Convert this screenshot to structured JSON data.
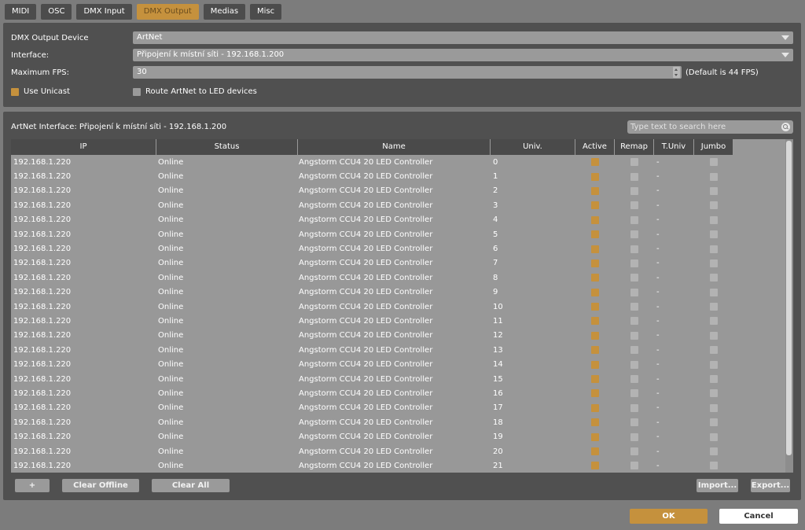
{
  "tabs": [
    "MIDI",
    "OSC",
    "DMX Input",
    "DMX Output",
    "Medias",
    "Misc"
  ],
  "active_tab": "DMX Output",
  "settings": {
    "device_label": "DMX Output Device",
    "device_value": "ArtNet",
    "interface_label": "Interface:",
    "interface_value": "Připojení k místní síti - 192.168.1.200",
    "fps_label": "Maximum FPS:",
    "fps_value": "30",
    "fps_hint": "(Default is 44 FPS)",
    "use_unicast_label": "Use Unicast",
    "use_unicast_checked": true,
    "route_label": "Route ArtNet to LED devices",
    "route_checked": false
  },
  "panel": {
    "interface_label": "ArtNet Interface: Připojení k místní síti - 192.168.1.200",
    "search_placeholder": "Type text to search here"
  },
  "table": {
    "headers": [
      "IP",
      "Status",
      "Name",
      "Univ.",
      "Active",
      "Remap",
      "T.Univ",
      "Jumbo"
    ],
    "rows": [
      {
        "ip": "192.168.1.220",
        "status": "Online",
        "name": "Angstorm CCU4 20 LED Controller",
        "univ": "0",
        "active": true,
        "remap": false,
        "tuniv": "-",
        "jumbo": false
      },
      {
        "ip": "192.168.1.220",
        "status": "Online",
        "name": "Angstorm CCU4 20 LED Controller",
        "univ": "1",
        "active": true,
        "remap": false,
        "tuniv": "-",
        "jumbo": false
      },
      {
        "ip": "192.168.1.220",
        "status": "Online",
        "name": "Angstorm CCU4 20 LED Controller",
        "univ": "2",
        "active": true,
        "remap": false,
        "tuniv": "-",
        "jumbo": false
      },
      {
        "ip": "192.168.1.220",
        "status": "Online",
        "name": "Angstorm CCU4 20 LED Controller",
        "univ": "3",
        "active": true,
        "remap": false,
        "tuniv": "-",
        "jumbo": false
      },
      {
        "ip": "192.168.1.220",
        "status": "Online",
        "name": "Angstorm CCU4 20 LED Controller",
        "univ": "4",
        "active": true,
        "remap": false,
        "tuniv": "-",
        "jumbo": false
      },
      {
        "ip": "192.168.1.220",
        "status": "Online",
        "name": "Angstorm CCU4 20 LED Controller",
        "univ": "5",
        "active": true,
        "remap": false,
        "tuniv": "-",
        "jumbo": false
      },
      {
        "ip": "192.168.1.220",
        "status": "Online",
        "name": "Angstorm CCU4 20 LED Controller",
        "univ": "6",
        "active": true,
        "remap": false,
        "tuniv": "-",
        "jumbo": false
      },
      {
        "ip": "192.168.1.220",
        "status": "Online",
        "name": "Angstorm CCU4 20 LED Controller",
        "univ": "7",
        "active": true,
        "remap": false,
        "tuniv": "-",
        "jumbo": false
      },
      {
        "ip": "192.168.1.220",
        "status": "Online",
        "name": "Angstorm CCU4 20 LED Controller",
        "univ": "8",
        "active": true,
        "remap": false,
        "tuniv": "-",
        "jumbo": false
      },
      {
        "ip": "192.168.1.220",
        "status": "Online",
        "name": "Angstorm CCU4 20 LED Controller",
        "univ": "9",
        "active": true,
        "remap": false,
        "tuniv": "-",
        "jumbo": false
      },
      {
        "ip": "192.168.1.220",
        "status": "Online",
        "name": "Angstorm CCU4 20 LED Controller",
        "univ": "10",
        "active": true,
        "remap": false,
        "tuniv": "-",
        "jumbo": false
      },
      {
        "ip": "192.168.1.220",
        "status": "Online",
        "name": "Angstorm CCU4 20 LED Controller",
        "univ": "11",
        "active": true,
        "remap": false,
        "tuniv": "-",
        "jumbo": false
      },
      {
        "ip": "192.168.1.220",
        "status": "Online",
        "name": "Angstorm CCU4 20 LED Controller",
        "univ": "12",
        "active": true,
        "remap": false,
        "tuniv": "-",
        "jumbo": false
      },
      {
        "ip": "192.168.1.220",
        "status": "Online",
        "name": "Angstorm CCU4 20 LED Controller",
        "univ": "13",
        "active": true,
        "remap": false,
        "tuniv": "-",
        "jumbo": false
      },
      {
        "ip": "192.168.1.220",
        "status": "Online",
        "name": "Angstorm CCU4 20 LED Controller",
        "univ": "14",
        "active": true,
        "remap": false,
        "tuniv": "-",
        "jumbo": false
      },
      {
        "ip": "192.168.1.220",
        "status": "Online",
        "name": "Angstorm CCU4 20 LED Controller",
        "univ": "15",
        "active": true,
        "remap": false,
        "tuniv": "-",
        "jumbo": false
      },
      {
        "ip": "192.168.1.220",
        "status": "Online",
        "name": "Angstorm CCU4 20 LED Controller",
        "univ": "16",
        "active": true,
        "remap": false,
        "tuniv": "-",
        "jumbo": false
      },
      {
        "ip": "192.168.1.220",
        "status": "Online",
        "name": "Angstorm CCU4 20 LED Controller",
        "univ": "17",
        "active": true,
        "remap": false,
        "tuniv": "-",
        "jumbo": false
      },
      {
        "ip": "192.168.1.220",
        "status": "Online",
        "name": "Angstorm CCU4 20 LED Controller",
        "univ": "18",
        "active": true,
        "remap": false,
        "tuniv": "-",
        "jumbo": false
      },
      {
        "ip": "192.168.1.220",
        "status": "Online",
        "name": "Angstorm CCU4 20 LED Controller",
        "univ": "19",
        "active": true,
        "remap": false,
        "tuniv": "-",
        "jumbo": false
      },
      {
        "ip": "192.168.1.220",
        "status": "Online",
        "name": "Angstorm CCU4 20 LED Controller",
        "univ": "20",
        "active": true,
        "remap": false,
        "tuniv": "-",
        "jumbo": false
      },
      {
        "ip": "192.168.1.220",
        "status": "Online",
        "name": "Angstorm CCU4 20 LED Controller",
        "univ": "21",
        "active": true,
        "remap": false,
        "tuniv": "-",
        "jumbo": false
      }
    ]
  },
  "buttons": {
    "add": "+",
    "clear_offline": "Clear Offline",
    "clear_all": "Clear All",
    "import": "Import...",
    "export": "Export...",
    "ok": "OK",
    "cancel": "Cancel"
  },
  "colors": {
    "accent": "#c5913d",
    "panel": "#505050",
    "background": "#7c7c7c"
  }
}
